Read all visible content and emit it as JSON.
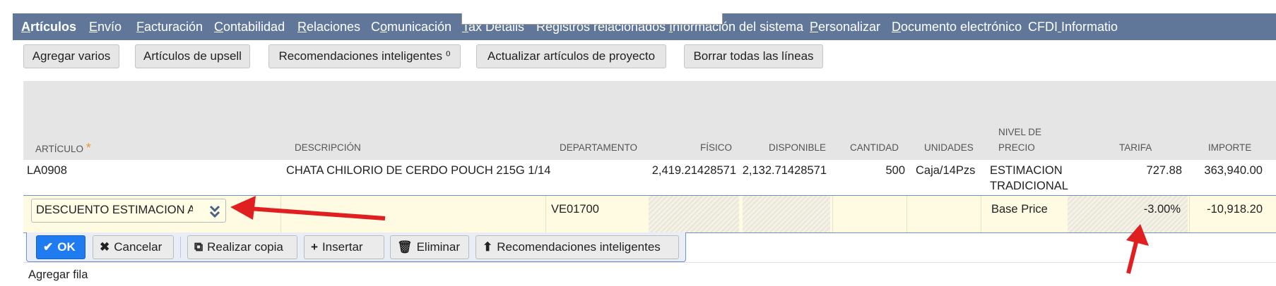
{
  "tabs": [
    {
      "pre": "",
      "u": "A",
      "post": "rtículos",
      "active": true
    },
    {
      "pre": "",
      "u": "E",
      "post": "nvío",
      "active": false
    },
    {
      "pre": "",
      "u": "F",
      "post": "acturación",
      "active": false
    },
    {
      "pre": "",
      "u": "C",
      "post": "ontabilidad",
      "active": false
    },
    {
      "pre": "",
      "u": "R",
      "post": "elaciones",
      "active": false
    },
    {
      "pre": "C",
      "u": "o",
      "post": "municación",
      "active": false
    },
    {
      "pre": "",
      "u": "T",
      "post": "ax Details",
      "active": false
    },
    {
      "pre": "Registros relacionados",
      "u": "",
      "post": "",
      "active": false
    },
    {
      "pre": "",
      "u": "I",
      "post": "nformación del sistema",
      "active": false
    },
    {
      "pre": "",
      "u": "P",
      "post": "ersonalizar",
      "active": false
    },
    {
      "pre": "",
      "u": "D",
      "post": "ocumento electrónico",
      "active": false
    },
    {
      "pre": "CFDI",
      "u": " ",
      "post": "Informatio",
      "active": false
    }
  ],
  "actions": {
    "agregar_varios": "Agregar varios",
    "upsell": "Artículos de upsell",
    "recomendaciones": "Recomendaciones inteligentes ⁰",
    "actualizar": "Actualizar artículos de proyecto",
    "borrar": "Borrar todas las líneas"
  },
  "columns": {
    "articulo": "ARTÍCULO",
    "required_mark": "*",
    "descripcion": "DESCRIPCIÓN",
    "departamento": "DEPARTAMENTO",
    "fisico": "FÍSICO",
    "disponible": "DISPONIBLE",
    "cantidad": "CANTIDAD",
    "unidades": "UNIDADES",
    "nivel_precio_1": "NIVEL DE",
    "nivel_precio_2": "PRECIO",
    "tarifa": "TARIFA",
    "importe": "IMPORTE"
  },
  "row1": {
    "articulo": "LA0908",
    "descripcion": "CHATA CHILORIO DE CERDO POUCH 215G 1/14",
    "fisico": "2,419.21428571",
    "disponible": "2,132.71428571",
    "cantidad": "500",
    "unidades": "Caja/14Pzs",
    "nivel_precio_1": "ESTIMACION",
    "nivel_precio_2": "TRADICIONAL",
    "tarifa": "727.88",
    "importe": "363,940.00"
  },
  "edit_row": {
    "articulo": "DESCUENTO ESTIMACION ARTICULOS",
    "departamento": "VE01700",
    "nivel_precio": "Base Price",
    "tarifa": "-3.00%",
    "importe": "-10,918.20"
  },
  "toolbar": {
    "ok": "OK",
    "cancelar": "Cancelar",
    "copia": "Realizar copia",
    "insertar": "Insertar",
    "eliminar": "Eliminar",
    "recomendaciones": "Recomendaciones inteligentes"
  },
  "agregar_fila": "Agregar fila",
  "colors": {
    "tabbar": "#607799",
    "ok_button": "#1e7cf0",
    "edit_row": "#fffbe3",
    "annotation_arrow": "#e02020"
  }
}
